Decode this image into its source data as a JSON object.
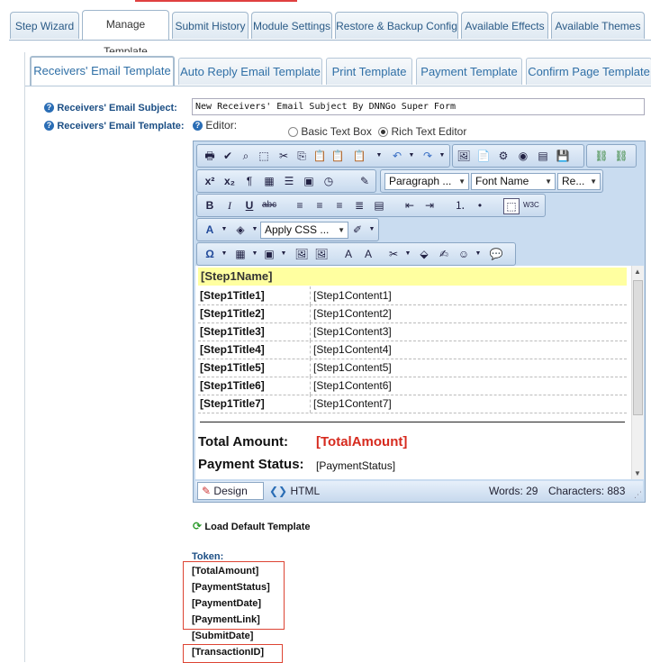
{
  "top_tabs": [
    "Step Wizard",
    "Manage Template",
    "Submit History",
    "Module Settings",
    "Restore & Backup Config",
    "Available Effects",
    "Available Themes"
  ],
  "sub_tabs": [
    "Receivers' Email Template",
    "Auto Reply Email Template",
    "Print Template",
    "Payment Template",
    "Confirm Page Template"
  ],
  "subject": {
    "label": "Receivers' Email Subject:",
    "value": "New Receivers' Email Subject By DNNGo Super Form"
  },
  "template": {
    "label": "Receivers' Email Template:",
    "editor_label": "Editor:",
    "options": [
      "Basic Text Box",
      "Rich Text Editor"
    ],
    "selected": "Rich Text Editor"
  },
  "toolbar": {
    "paragraph": "Paragraph ...",
    "font_name": "Font Name",
    "font_size": "Re...",
    "apply_css": "Apply CSS ..."
  },
  "content": {
    "header": "[Step1Name]",
    "rows": [
      {
        "k": "[Step1Title1]",
        "v": "[Step1Content1]"
      },
      {
        "k": "[Step1Title2]",
        "v": "[Step1Content2]"
      },
      {
        "k": "[Step1Title3]",
        "v": "[Step1Content3]"
      },
      {
        "k": "[Step1Title4]",
        "v": "[Step1Content4]"
      },
      {
        "k": "[Step1Title5]",
        "v": "[Step1Content5]"
      },
      {
        "k": "[Step1Title6]",
        "v": "[Step1Content6]"
      },
      {
        "k": "[Step1Title7]",
        "v": "[Step1Content7]"
      }
    ],
    "total_label": "Total Amount:",
    "total_value": "[TotalAmount]",
    "status_label": "Payment Status:",
    "status_value": "[PaymentStatus]"
  },
  "statusbar": {
    "design": "Design",
    "html": "HTML",
    "words": "Words: 29",
    "chars": "Characters: 883"
  },
  "load_default": "Load Default Template",
  "token_label": "Token:",
  "tokens": [
    "[TotalAmount]",
    "[PaymentStatus]",
    "[PaymentDate]",
    "[PaymentLink]",
    "[SubmitDate]",
    "[TransactionID]"
  ],
  "colors": {
    "accent": "#2f6fa6",
    "highlight": "#ffffa0",
    "red": "#d62a1e"
  }
}
